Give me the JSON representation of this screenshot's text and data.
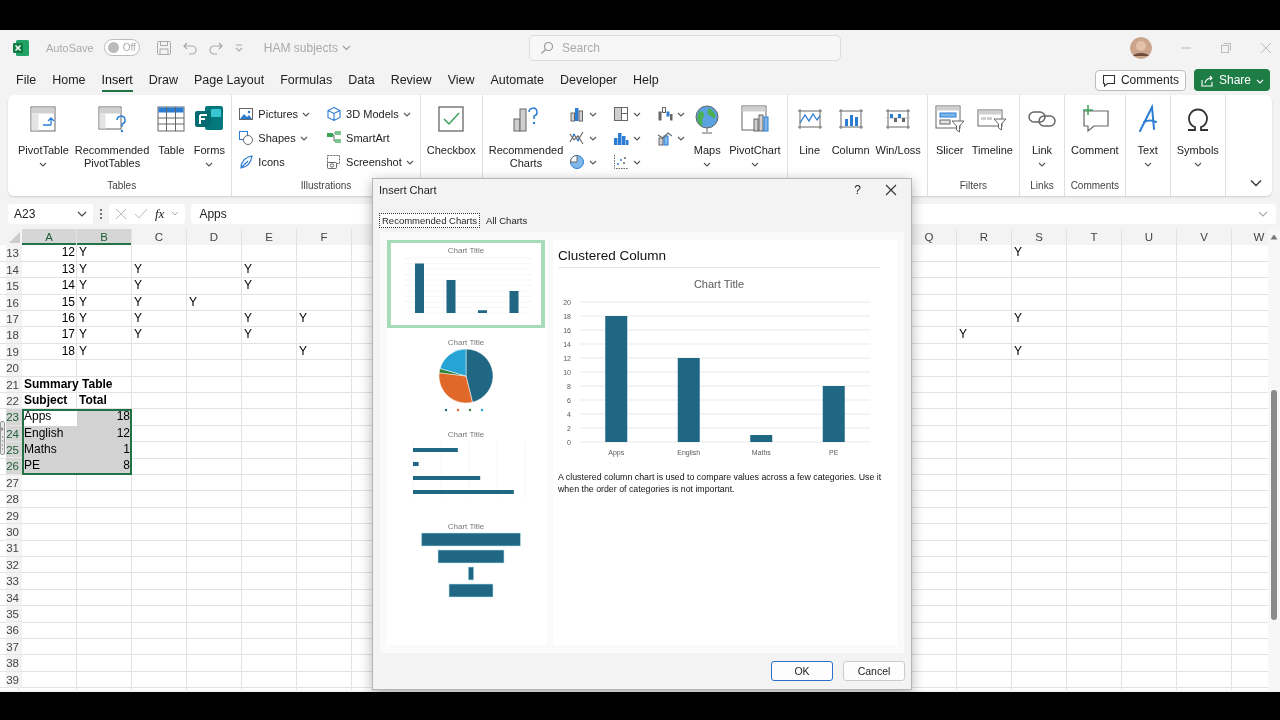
{
  "titlebar": {
    "autosave": {
      "label": "AutoSave",
      "on": false,
      "state_text": "Off"
    },
    "document_title": "HAM subjects",
    "search": {
      "placeholder": "Search"
    }
  },
  "menu_tabs": [
    {
      "label": "File",
      "selected": false
    },
    {
      "label": "Home",
      "selected": false
    },
    {
      "label": "Insert",
      "selected": true
    },
    {
      "label": "Draw",
      "selected": false
    },
    {
      "label": "Page Layout",
      "selected": false
    },
    {
      "label": "Formulas",
      "selected": false
    },
    {
      "label": "Data",
      "selected": false
    },
    {
      "label": "Review",
      "selected": false
    },
    {
      "label": "View",
      "selected": false
    },
    {
      "label": "Automate",
      "selected": false
    },
    {
      "label": "Developer",
      "selected": false
    },
    {
      "label": "Help",
      "selected": false
    }
  ],
  "comments_button": "Comments",
  "share_button": "Share",
  "ribbon": {
    "groups": [
      {
        "label": "Tables",
        "items": [
          {
            "label": "PivotTable",
            "kind": "large",
            "dropdown": true
          },
          {
            "label": "Recommended PivotTables",
            "kind": "large",
            "dropdown": false
          },
          {
            "label": "Table",
            "kind": "large",
            "dropdown": false
          },
          {
            "label": "Forms",
            "kind": "large",
            "dropdown": true
          }
        ]
      },
      {
        "label": "Illustrations",
        "items": [
          {
            "label": "Pictures",
            "kind": "small",
            "dropdown": true
          },
          {
            "label": "Shapes",
            "kind": "small",
            "dropdown": true
          },
          {
            "label": "Icons",
            "kind": "small",
            "dropdown": false
          },
          {
            "label": "3D Models",
            "kind": "small",
            "dropdown": true
          },
          {
            "label": "SmartArt",
            "kind": "small",
            "dropdown": false
          },
          {
            "label": "Screenshot",
            "kind": "small",
            "dropdown": true
          }
        ]
      },
      {
        "items": [
          {
            "label": "Checkbox",
            "kind": "large",
            "dropdown": false
          }
        ]
      },
      {
        "items": [
          {
            "label": "Recommended Charts",
            "kind": "large",
            "dropdown": false
          },
          {
            "kind": "icon",
            "dropdown": true
          },
          {
            "kind": "icon",
            "dropdown": true
          },
          {
            "kind": "icon",
            "dropdown": true
          },
          {
            "kind": "icon",
            "dropdown": true
          },
          {
            "kind": "icon",
            "dropdown": true
          },
          {
            "kind": "icon",
            "dropdown": true
          },
          {
            "kind": "icon",
            "dropdown": true
          },
          {
            "kind": "icon",
            "dropdown": true
          },
          {
            "label": "Maps",
            "kind": "large",
            "dropdown": true
          },
          {
            "label": "PivotChart",
            "kind": "large",
            "dropdown": true
          }
        ]
      },
      {
        "items": [
          {
            "label": "Line",
            "kind": "large",
            "dropdown": false
          },
          {
            "label": "Column",
            "kind": "large",
            "dropdown": false
          },
          {
            "label": "Win/Loss",
            "kind": "large",
            "dropdown": false
          }
        ]
      },
      {
        "label": "Filters",
        "items": [
          {
            "label": "Slicer",
            "kind": "large",
            "dropdown": false
          },
          {
            "label": "Timeline",
            "kind": "large",
            "dropdown": false
          }
        ]
      },
      {
        "label": "Links",
        "items": [
          {
            "label": "Link",
            "kind": "large",
            "dropdown": true
          }
        ]
      },
      {
        "label": "Comments",
        "items": [
          {
            "label": "Comment",
            "kind": "large",
            "dropdown": false
          }
        ]
      },
      {
        "items": [
          {
            "label": "Text",
            "kind": "large",
            "dropdown": true
          }
        ]
      },
      {
        "items": [
          {
            "label": "Symbols",
            "kind": "large",
            "dropdown": true
          }
        ]
      }
    ]
  },
  "formula_bar": {
    "name_box": "A23",
    "function_label": "fx",
    "value": "Apps"
  },
  "sheet": {
    "left_columns": [
      {
        "label": "A",
        "selected": true
      },
      {
        "label": "B",
        "selected": true
      },
      {
        "label": "C",
        "selected": false
      },
      {
        "label": "D",
        "selected": false
      },
      {
        "label": "E",
        "selected": false
      },
      {
        "label": "F",
        "selected": false
      }
    ],
    "right_columns": [
      {
        "label": "Q",
        "selected": false
      },
      {
        "label": "R",
        "selected": false
      },
      {
        "label": "S",
        "selected": false
      },
      {
        "label": "T",
        "selected": false
      },
      {
        "label": "U",
        "selected": false
      },
      {
        "label": "V",
        "selected": false
      },
      {
        "label": "W",
        "selected": false
      }
    ],
    "rows": [
      {
        "number": "13",
        "selected": false,
        "cells": [
          {
            "text": "12",
            "kind": "number"
          },
          {
            "text": "Y",
            "kind": "text"
          },
          null,
          null,
          null,
          null
        ],
        "right_cells": [
          null,
          null,
          {
            "text": "Y",
            "kind": "text"
          },
          null,
          null,
          null,
          null
        ]
      },
      {
        "number": "14",
        "selected": false,
        "cells": [
          {
            "text": "13",
            "kind": "number"
          },
          {
            "text": "Y",
            "kind": "text"
          },
          {
            "text": "Y",
            "kind": "text"
          },
          null,
          {
            "text": "Y",
            "kind": "text"
          },
          null
        ]
      },
      {
        "number": "15",
        "selected": false,
        "cells": [
          {
            "text": "14",
            "kind": "number"
          },
          {
            "text": "Y",
            "kind": "text"
          },
          {
            "text": "Y",
            "kind": "text"
          },
          null,
          {
            "text": "Y",
            "kind": "text"
          },
          null
        ]
      },
      {
        "number": "16",
        "selected": false,
        "cells": [
          {
            "text": "15",
            "kind": "number"
          },
          {
            "text": "Y",
            "kind": "text"
          },
          {
            "text": "Y",
            "kind": "text"
          },
          {
            "text": "Y",
            "kind": "text"
          },
          null,
          null
        ]
      },
      {
        "number": "17",
        "selected": false,
        "cells": [
          {
            "text": "16",
            "kind": "number"
          },
          {
            "text": "Y",
            "kind": "text"
          },
          {
            "text": "Y",
            "kind": "text"
          },
          null,
          {
            "text": "Y",
            "kind": "text"
          },
          {
            "text": "Y",
            "kind": "text"
          }
        ],
        "right_cells": [
          null,
          null,
          {
            "text": "Y",
            "kind": "text"
          },
          null,
          null,
          null,
          null
        ]
      },
      {
        "number": "18",
        "selected": false,
        "cells": [
          {
            "text": "17",
            "kind": "number"
          },
          {
            "text": "Y",
            "kind": "text"
          },
          {
            "text": "Y",
            "kind": "text"
          },
          null,
          {
            "text": "Y",
            "kind": "text"
          },
          null
        ],
        "right_cells": [
          null,
          {
            "text": "Y",
            "kind": "text"
          },
          null,
          null,
          null,
          null,
          null
        ]
      },
      {
        "number": "19",
        "selected": false,
        "cells": [
          {
            "text": "18",
            "kind": "number"
          },
          {
            "text": "Y",
            "kind": "text"
          },
          null,
          null,
          null,
          {
            "text": "Y",
            "kind": "text"
          }
        ],
        "right_cells": [
          null,
          null,
          {
            "text": "Y",
            "kind": "text"
          },
          null,
          null,
          null,
          null
        ]
      },
      {
        "number": "20",
        "selected": false
      },
      {
        "number": "21",
        "selected": false,
        "bold": true,
        "cells": [
          {
            "text": "Summary Table",
            "kind": "text"
          },
          null,
          null,
          null,
          null,
          null
        ]
      },
      {
        "number": "22",
        "selected": false,
        "bold": true,
        "cells": [
          {
            "text": "Subject",
            "kind": "text"
          },
          {
            "text": "Total",
            "kind": "text"
          },
          null,
          null,
          null,
          null
        ]
      },
      {
        "number": "23",
        "selected": true,
        "active": true,
        "cells": [
          {
            "text": "Apps",
            "kind": "text"
          },
          {
            "text": "18",
            "kind": "number"
          },
          null,
          null,
          null,
          null
        ]
      },
      {
        "number": "24",
        "selected": true,
        "cells": [
          {
            "text": "English",
            "kind": "text"
          },
          {
            "text": "12",
            "kind": "number"
          },
          null,
          null,
          null,
          null
        ]
      },
      {
        "number": "25",
        "selected": true,
        "cells": [
          {
            "text": "Maths",
            "kind": "text"
          },
          {
            "text": "1",
            "kind": "number"
          },
          null,
          null,
          null,
          null
        ]
      },
      {
        "number": "26",
        "selected": true,
        "cells": [
          {
            "text": "PE",
            "kind": "text"
          },
          {
            "text": "8",
            "kind": "number"
          },
          null,
          null,
          null,
          null
        ]
      },
      {
        "number": "27",
        "selected": false
      },
      {
        "number": "28",
        "selected": false
      },
      {
        "number": "29",
        "selected": false
      },
      {
        "number": "30",
        "selected": false
      },
      {
        "number": "31",
        "selected": false
      },
      {
        "number": "32",
        "selected": false
      },
      {
        "number": "33",
        "selected": false
      },
      {
        "number": "34",
        "selected": false
      },
      {
        "number": "35",
        "selected": false
      },
      {
        "number": "36",
        "selected": false
      },
      {
        "number": "37",
        "selected": false
      },
      {
        "number": "38",
        "selected": false
      },
      {
        "number": "39",
        "selected": false
      }
    ]
  },
  "dialog": {
    "title": "Insert Chart",
    "help_button": "?",
    "tabs": [
      {
        "label": "Recommended Charts",
        "selected": true
      },
      {
        "label": "All Charts",
        "selected": false
      }
    ],
    "thumbnails": [
      {
        "kind": "column",
        "title": "Chart Title",
        "selected": true
      },
      {
        "kind": "pie",
        "title": "Chart Title",
        "selected": false
      },
      {
        "kind": "bar",
        "title": "Chart Title",
        "selected": false
      },
      {
        "kind": "funnel",
        "title": "Chart Title",
        "selected": false
      }
    ],
    "preview": {
      "heading": "Clustered Column",
      "chart_data": {
        "type": "bar",
        "title": "Chart Title",
        "categories": [
          "Apps",
          "English",
          "Maths",
          "PE"
        ],
        "series": [
          {
            "color": "#1f6783",
            "values": [
              18,
              12,
              1,
              8
            ]
          }
        ],
        "ylim": [
          0,
          20
        ],
        "yticks": [
          0,
          2,
          4,
          6,
          8,
          10,
          12,
          14,
          16,
          18,
          20
        ],
        "grid": true
      },
      "description": "A clustered column chart is used to compare values across a few categories. Use it when the order of categories is not important."
    },
    "buttons": [
      {
        "label": "OK",
        "default": true
      },
      {
        "label": "Cancel",
        "default": false
      }
    ]
  }
}
